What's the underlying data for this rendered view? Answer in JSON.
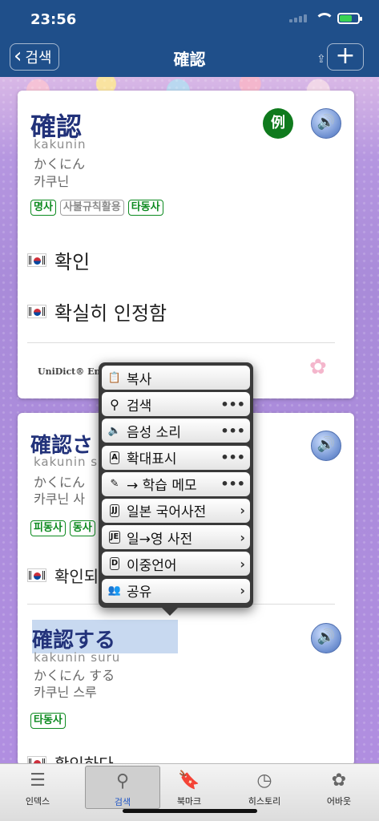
{
  "status": {
    "time": "23:56"
  },
  "nav": {
    "back_label": "검색",
    "title": "確認",
    "add_label": "+"
  },
  "entries": [
    {
      "headword": "確認",
      "romaji": "kakunin",
      "kana": "かくにん",
      "hangul": "카쿠닌",
      "tags": [
        "명사",
        "사불규칙활용",
        "타동사"
      ],
      "meanings": [
        "확인",
        "확실히 인정함"
      ],
      "example_badge": "例",
      "attribution": "UniDict® Enfo"
    },
    {
      "headword": "確認さ",
      "romaji": "kakunin s",
      "kana": "かくにん",
      "hangul": "카쿠닌 사",
      "tags": [
        "피동사",
        "동사"
      ],
      "meanings": [
        "확인되"
      ]
    },
    {
      "headword": "確認する",
      "romaji": "kakunin suru",
      "kana": "かくにん する",
      "hangul": "카쿠닌 스루",
      "tags": [
        "타동사"
      ],
      "meanings": [
        "확인하다"
      ]
    }
  ],
  "context_menu": {
    "items": [
      {
        "label": "복사",
        "icon": "clipboard-icon",
        "trail": ""
      },
      {
        "label": "검색",
        "icon": "search-icon",
        "trail": "•••"
      },
      {
        "label": "음성 소리",
        "icon": "speaker-icon",
        "trail": "•••"
      },
      {
        "label": "확대표시",
        "icon": "zoom-box-icon",
        "icon_text": "A",
        "trail": "•••"
      },
      {
        "label": "→ 학습 메모",
        "icon": "note-pencil-icon",
        "trail": "•••"
      },
      {
        "label": "일본 국어사전",
        "icon": "jj-dict-icon",
        "icon_text": "JJ",
        "trail": "›"
      },
      {
        "label": "일→영 사전",
        "icon": "je-dict-icon",
        "icon_text": "JE",
        "trail": "›"
      },
      {
        "label": "이중언어",
        "icon": "d-dict-icon",
        "icon_text": "D",
        "trail": "›"
      },
      {
        "label": "공유",
        "icon": "people-icon",
        "trail": "›"
      }
    ]
  },
  "tabbar": {
    "tabs": [
      {
        "label": "인덱스",
        "icon": "list-icon"
      },
      {
        "label": "검색",
        "icon": "magnifier-icon",
        "active": true
      },
      {
        "label": "북마크",
        "icon": "bookmark-icon"
      },
      {
        "label": "히스토리",
        "icon": "clock-icon"
      },
      {
        "label": "어바웃",
        "icon": "flower-icon"
      }
    ]
  }
}
